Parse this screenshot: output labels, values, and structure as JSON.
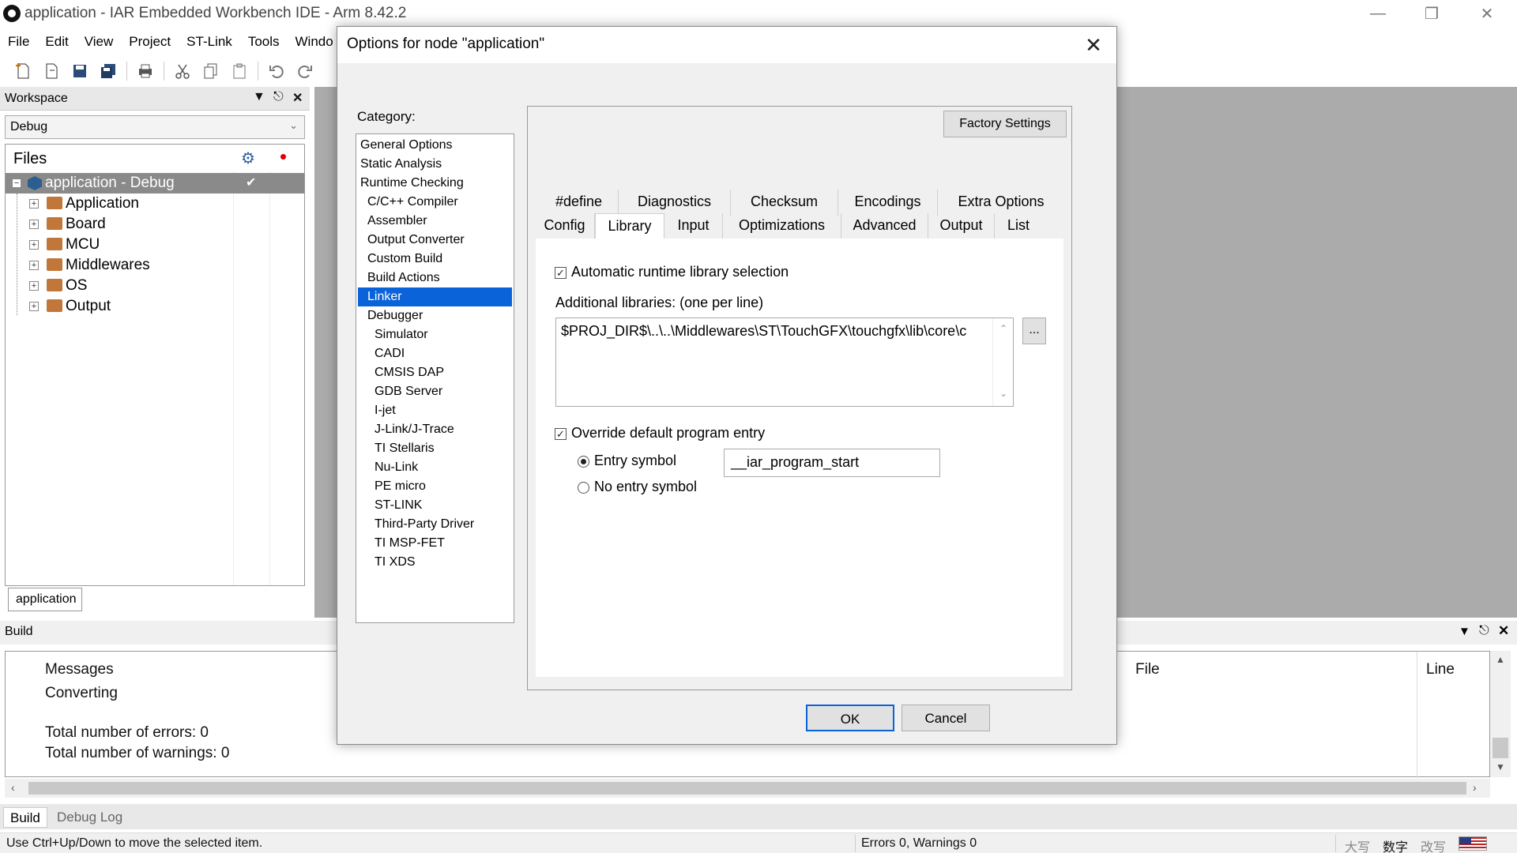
{
  "window": {
    "title": "application - IAR Embedded Workbench IDE - Arm 8.42.2"
  },
  "menu": [
    "File",
    "Edit",
    "View",
    "Project",
    "ST-Link",
    "Tools",
    "Windo"
  ],
  "workspace": {
    "title": "Workspace",
    "config": "Debug",
    "files_header": "Files",
    "project": "application - Debug",
    "folders": [
      "Application",
      "Board",
      "MCU",
      "Middlewares",
      "OS",
      "Output"
    ],
    "tab": "application"
  },
  "build": {
    "title": "Build",
    "messages_header": "Messages",
    "file_header": "File",
    "line_header": "Line",
    "lines": [
      "Converting",
      "Total number of errors: 0",
      "Total number of warnings: 0"
    ],
    "tabs": [
      "Build",
      "Debug Log"
    ]
  },
  "status": {
    "hint": "Use Ctrl+Up/Down to move the selected item.",
    "summary": "Errors 0, Warnings 0",
    "ime": [
      "大写",
      "数字",
      "改写"
    ]
  },
  "dialog": {
    "title": "Options for node \"application\"",
    "category_label": "Category:",
    "categories": [
      {
        "label": "General Options",
        "indent": 0
      },
      {
        "label": "Static Analysis",
        "indent": 0
      },
      {
        "label": "Runtime Checking",
        "indent": 0
      },
      {
        "label": "C/C++ Compiler",
        "indent": 1
      },
      {
        "label": "Assembler",
        "indent": 1
      },
      {
        "label": "Output Converter",
        "indent": 1
      },
      {
        "label": "Custom Build",
        "indent": 1
      },
      {
        "label": "Build Actions",
        "indent": 1
      },
      {
        "label": "Linker",
        "indent": 1,
        "selected": true
      },
      {
        "label": "Debugger",
        "indent": 1
      },
      {
        "label": "Simulator",
        "indent": 2
      },
      {
        "label": "CADI",
        "indent": 2
      },
      {
        "label": "CMSIS DAP",
        "indent": 2
      },
      {
        "label": "GDB Server",
        "indent": 2
      },
      {
        "label": "I-jet",
        "indent": 2
      },
      {
        "label": "J-Link/J-Trace",
        "indent": 2
      },
      {
        "label": "TI Stellaris",
        "indent": 2
      },
      {
        "label": "Nu-Link",
        "indent": 2
      },
      {
        "label": "PE micro",
        "indent": 2
      },
      {
        "label": "ST-LINK",
        "indent": 2
      },
      {
        "label": "Third-Party Driver",
        "indent": 2
      },
      {
        "label": "TI MSP-FET",
        "indent": 2
      },
      {
        "label": "TI XDS",
        "indent": 2
      }
    ],
    "factory_settings": "Factory Settings",
    "tabs_row1": [
      "#define",
      "Diagnostics",
      "Checksum",
      "Encodings",
      "Extra Options"
    ],
    "tabs_row2": [
      "Config",
      "Library",
      "Input",
      "Optimizations",
      "Advanced",
      "Output",
      "List"
    ],
    "active_tab": "Library",
    "auto_runtime_label": "Automatic runtime library selection",
    "auto_runtime_checked": true,
    "additional_libs_label": "Additional libraries: (one per line)",
    "additional_libs_value": "$PROJ_DIR$\\..\\..\\Middlewares\\ST\\TouchGFX\\touchgfx\\lib\\core\\c",
    "browse_label": "...",
    "override_entry_label": "Override default program entry",
    "override_entry_checked": true,
    "entry_symbol_label": "Entry symbol",
    "no_entry_symbol_label": "No entry symbol",
    "entry_symbol_value": "__iar_program_start",
    "ok": "OK",
    "cancel": "Cancel"
  },
  "colors": {
    "selection": "#0a63d8",
    "folder": "#c2773a",
    "background_gray": "#ababab"
  }
}
